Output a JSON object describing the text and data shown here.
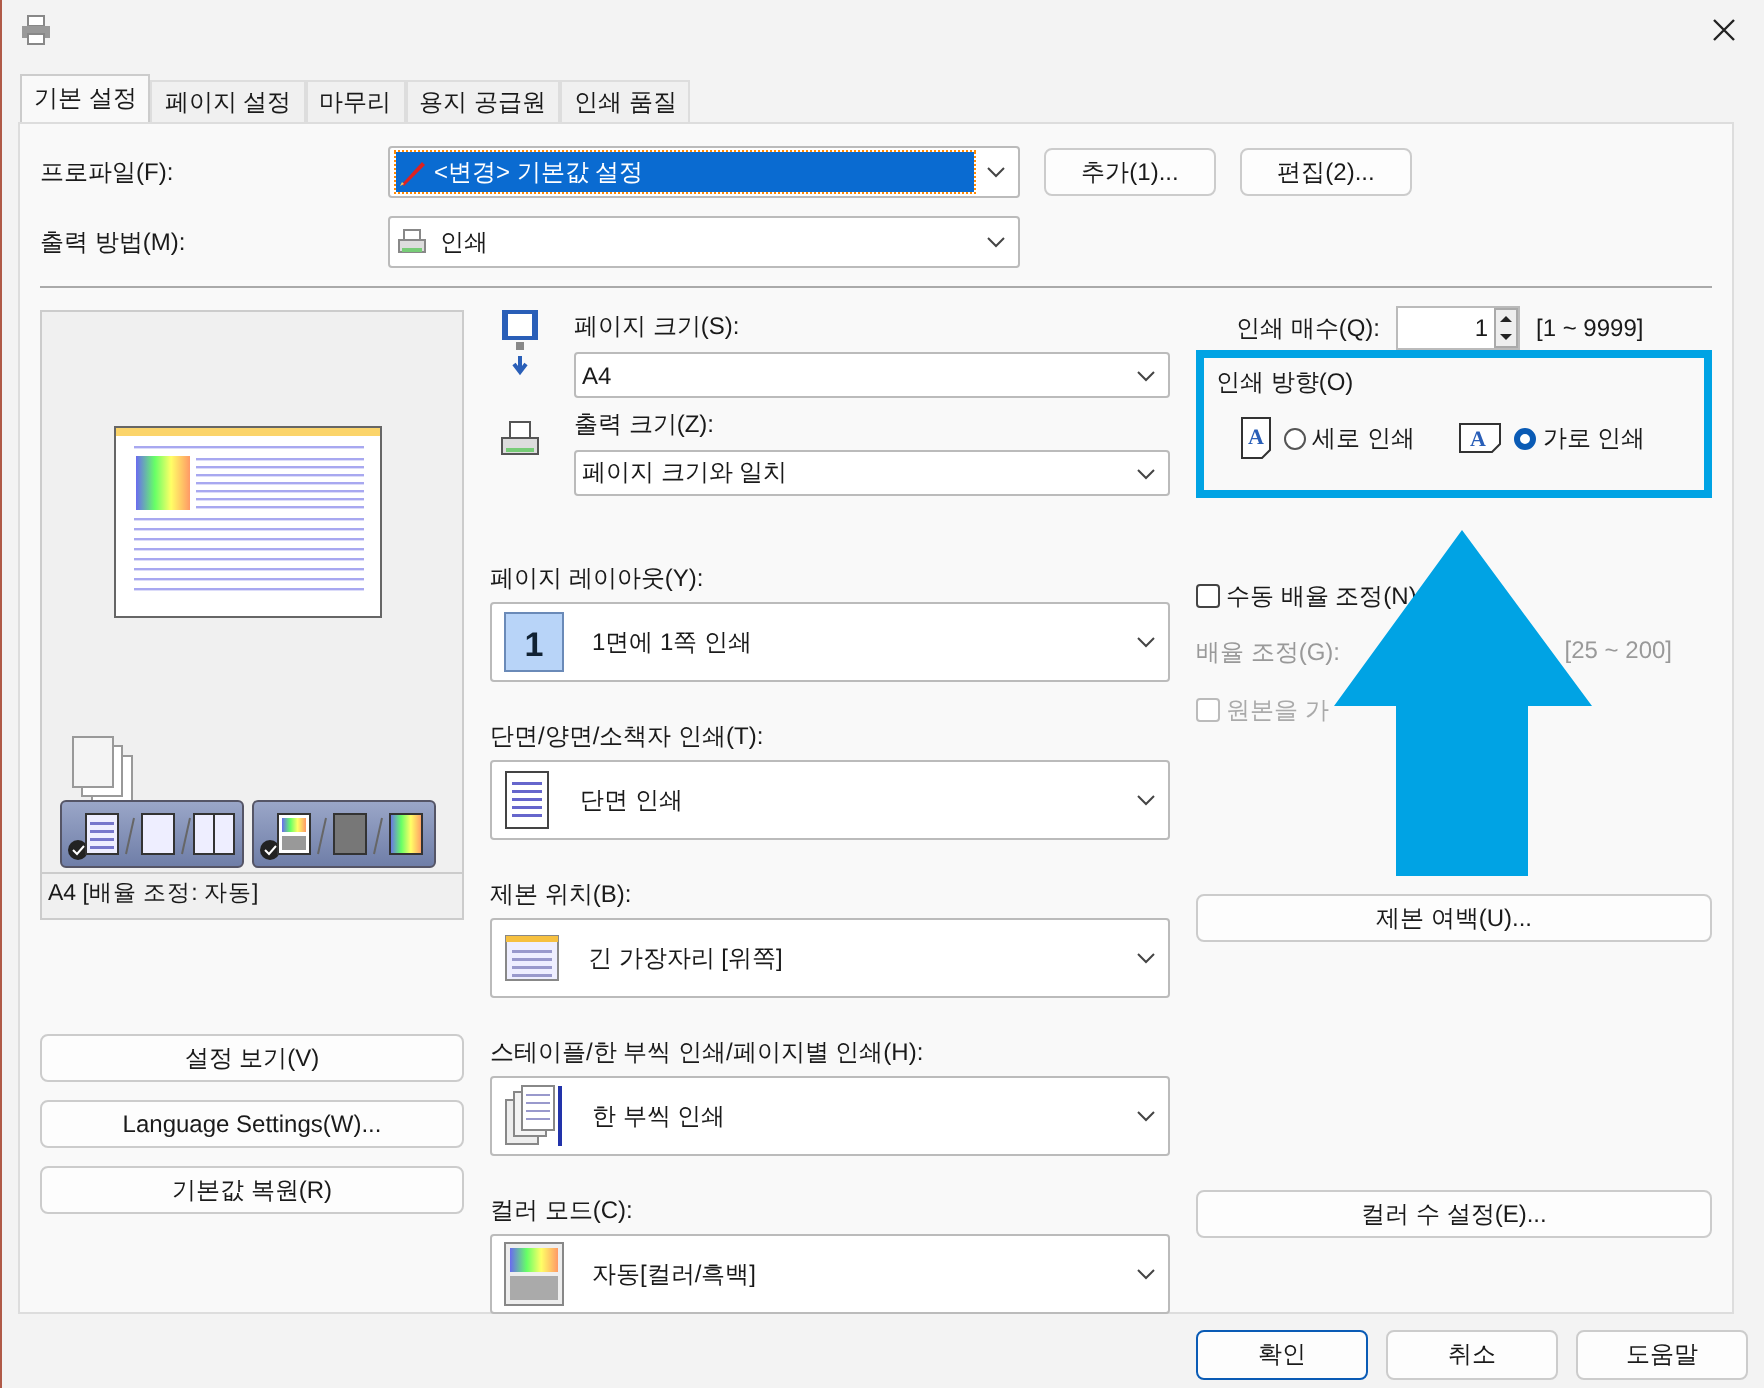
{
  "tabs": [
    {
      "label": "기본 설정",
      "selected": true
    },
    {
      "label": "페이지 설정",
      "selected": false
    },
    {
      "label": "마무리",
      "selected": false
    },
    {
      "label": "용지 공급원",
      "selected": false
    },
    {
      "label": "인쇄 품질",
      "selected": false
    }
  ],
  "profile": {
    "label": "프로파일(F):",
    "value": "<변경> 기본값 설정",
    "buttons": [
      "추가(1)...",
      "편집(2)..."
    ]
  },
  "output_method": {
    "label": "출력 방법(M):",
    "value": "인쇄"
  },
  "preview": {
    "caption": "A4 [배율 조정: 자동]"
  },
  "left_buttons": [
    "설정 보기(V)",
    "Language Settings(W)...",
    "기본값 복원(R)"
  ],
  "settings": [
    {
      "kind": "page-size",
      "label": "페이지 크기(S):",
      "value": "A4"
    },
    {
      "kind": "output-size",
      "label": "출력 크기(Z):",
      "value": "페이지 크기와 일치"
    },
    {
      "kind": "layout",
      "label": "페이지 레이아웃(Y):",
      "value": "1면에 1쪽 인쇄",
      "icon_text": "1"
    },
    {
      "kind": "sides",
      "label": "단면/양면/소책자 인쇄(T):",
      "value": "단면 인쇄"
    },
    {
      "kind": "binding",
      "label": "제본 위치(B):",
      "value": "긴 가장자리 [위쪽]"
    },
    {
      "kind": "staple",
      "label": "스테이플/한 부씩 인쇄/페이지별 인쇄(H):",
      "value": "한 부씩 인쇄"
    },
    {
      "kind": "color",
      "label": "컬러 모드(C):",
      "value": "자동[컬러/흑백]"
    }
  ],
  "copies": {
    "label": "인쇄 매수(Q):",
    "value": "1",
    "range": "[1 ~ 9999]"
  },
  "orientation": {
    "label": "인쇄 방향(O)",
    "options": [
      {
        "kind": "portrait",
        "label": "세로 인쇄",
        "selected": false,
        "icon_text": "A"
      },
      {
        "kind": "landscape",
        "label": "가로 인쇄",
        "selected": true,
        "icon_text": "A"
      }
    ]
  },
  "manual_scale": {
    "label": "수동 배율 조정(N)",
    "checked": false
  },
  "scale": {
    "label": "배율 조정(G):",
    "range": "[25 ~ 200]",
    "disabled": true
  },
  "fit_original": {
    "label": "원본을 가",
    "checked": false,
    "disabled": true
  },
  "right_buttons": [
    "제본 여백(U)...",
    "컬러 수 설정(E)..."
  ],
  "dialog_buttons": [
    {
      "label": "확인",
      "default": true
    },
    {
      "label": "취소",
      "default": false
    },
    {
      "label": "도움말",
      "default": false
    }
  ]
}
